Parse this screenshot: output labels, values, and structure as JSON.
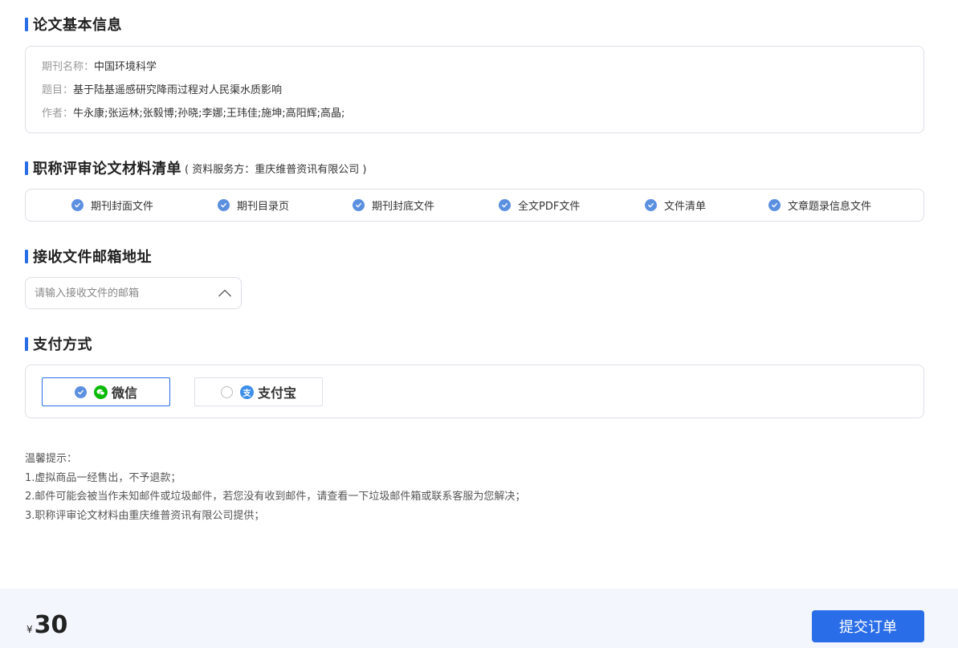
{
  "basic_info": {
    "title": "论文基本信息",
    "journal_label": "期刊名称：",
    "journal_value": "中国环境科学",
    "topic_label": "题目：",
    "topic_value": "基于陆基遥感研究降雨过程对人民渠水质影响",
    "author_label": "作者：",
    "author_value": "牛永康;张运林;张毅博;孙晓;李娜;王玮佳;施坤;高阳辉;高晶;"
  },
  "materials": {
    "title": "职称评审论文材料清单",
    "subtitle": "( 资料服务方：重庆维普资讯有限公司 )",
    "items": [
      {
        "label": "期刊封面文件"
      },
      {
        "label": "期刊目录页"
      },
      {
        "label": "期刊封底文件"
      },
      {
        "label": "全文PDF文件"
      },
      {
        "label": "文件清单"
      },
      {
        "label": "文章题录信息文件"
      }
    ],
    "check_color": "#5b8fe0"
  },
  "email": {
    "title": "接收文件邮箱地址",
    "placeholder": "请输入接收文件的邮箱",
    "value": ""
  },
  "payment": {
    "title": "支付方式",
    "options": [
      {
        "label": "微信",
        "selected": true,
        "icon": "wechat-icon",
        "color": "#09bb07"
      },
      {
        "label": "支付宝",
        "selected": false,
        "icon": "alipay-icon",
        "color": "#3b8eea",
        "glyph": "支"
      }
    ]
  },
  "tips": {
    "heading": "温馨提示：",
    "lines": [
      "1.虚拟商品一经售出，不予退款；",
      "2.邮件可能会被当作未知邮件或垃圾邮件，若您没有收到邮件，请查看一下垃圾邮件箱或联系客服为您解决；",
      "3.职称评审论文材料由重庆维普资讯有限公司提供；"
    ]
  },
  "footer": {
    "currency": "¥",
    "price": "30",
    "submit_label": "提交订单"
  },
  "colors": {
    "accent": "#2a6de8",
    "footer_bg": "#f3f6fd",
    "border": "#dcdfe6"
  }
}
